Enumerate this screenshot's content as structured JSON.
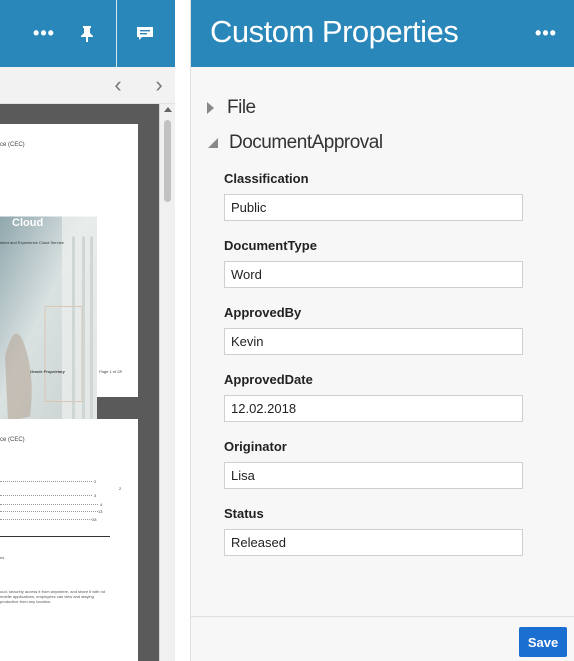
{
  "viewer": {
    "toolbar": {
      "more_icon": "more-dots-icon",
      "more_glyph": "•••",
      "pin_icon": "pin-icon",
      "comment_icon": "comment-icon"
    },
    "nav": {
      "prev_glyph": "‹",
      "next_glyph": "›"
    },
    "pages": [
      {
        "header": "ce (CEC)",
        "cover_lines": [
          "rn",
          "ess",
          "Cloud"
        ],
        "cover_subtitle": "ntent and Experience Cloud Service",
        "footer_left": "Oracle Proprietary",
        "footer_right": "Page 1 of 28"
      },
      {
        "header": "ce (CEC)",
        "toc_numbers": [
          "2",
          "2",
          "3",
          "4",
          "13",
          "28"
        ],
        "paragraph_1": "es",
        "paragraph_2": "oud, securely access it from anywhere, and share it with nd mobile applications, employees can view and staying productive from any location."
      }
    ]
  },
  "panel": {
    "title": "Custom Properties",
    "more_glyph": "•••",
    "sections": [
      {
        "label": "File",
        "expanded": false
      },
      {
        "label": "DocumentApproval",
        "expanded": true
      }
    ],
    "fields": [
      {
        "label": "Classification",
        "value": "Public"
      },
      {
        "label": "DocumentType",
        "value": "Word"
      },
      {
        "label": "ApprovedBy",
        "value": "Kevin"
      },
      {
        "label": "ApprovedDate",
        "value": "12.02.2018"
      },
      {
        "label": "Originator",
        "value": "Lisa"
      },
      {
        "label": "Status",
        "value": "Released"
      }
    ],
    "save_label": "Save"
  },
  "colors": {
    "header_blue": "#2a87b9",
    "save_blue": "#1a6fd0"
  }
}
